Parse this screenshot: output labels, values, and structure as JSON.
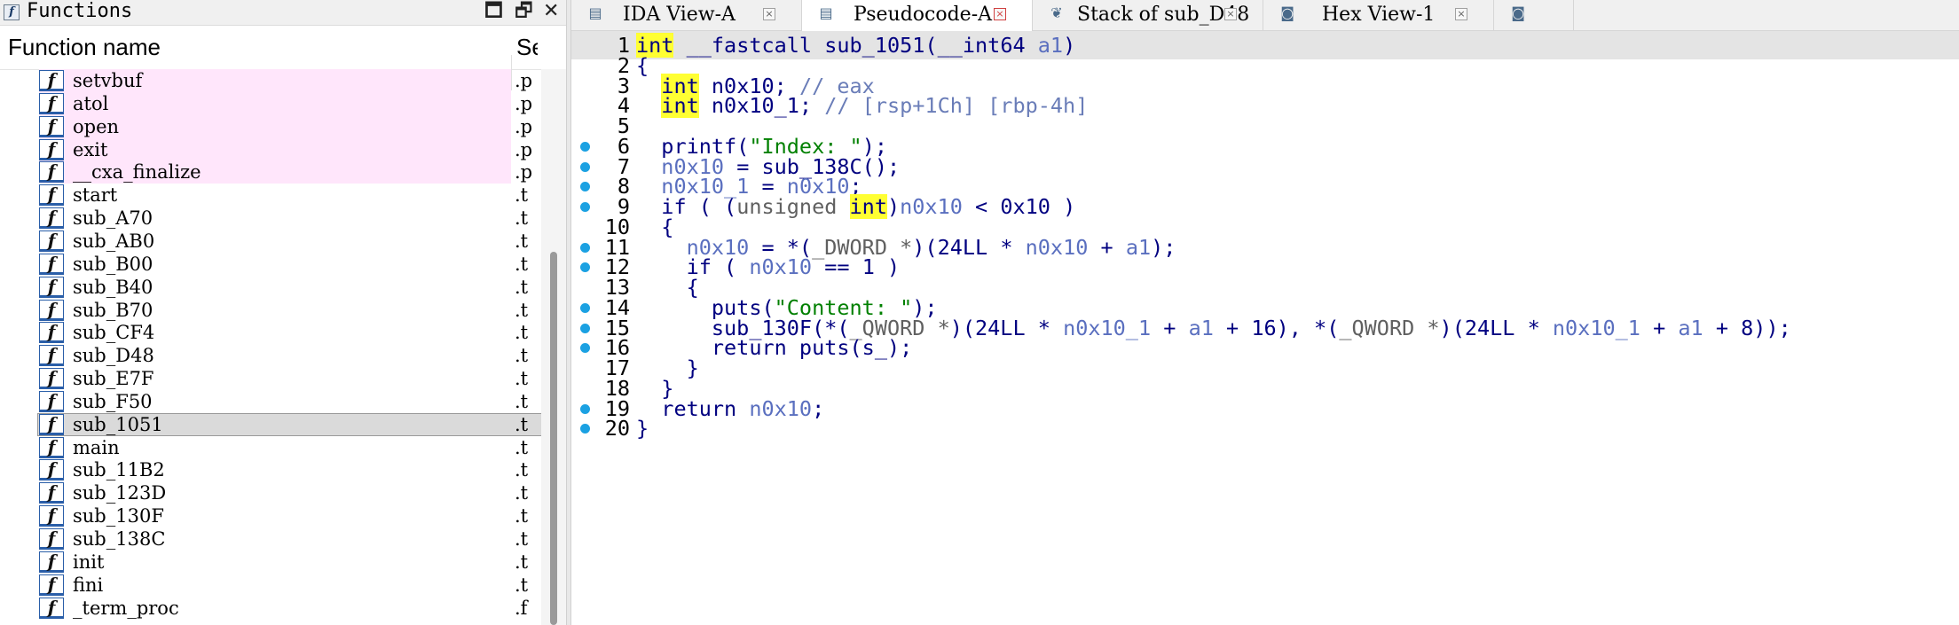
{
  "functions_panel": {
    "title": "Functions",
    "controls": {
      "maximize": "🗖",
      "float": "🗗",
      "close": "✕"
    },
    "columns": {
      "name": "Function name",
      "segment": "Se"
    },
    "rows": [
      {
        "name": "setvbuf",
        "seg": ".p",
        "kind": "import"
      },
      {
        "name": "atol",
        "seg": ".p",
        "kind": "import"
      },
      {
        "name": "open",
        "seg": ".p",
        "kind": "import"
      },
      {
        "name": "exit",
        "seg": ".p",
        "kind": "import"
      },
      {
        "name": "__cxa_finalize",
        "seg": ".p",
        "kind": "import"
      },
      {
        "name": "start",
        "seg": ".t",
        "kind": "normal"
      },
      {
        "name": "sub_A70",
        "seg": ".t",
        "kind": "normal"
      },
      {
        "name": "sub_AB0",
        "seg": ".t",
        "kind": "normal"
      },
      {
        "name": "sub_B00",
        "seg": ".t",
        "kind": "normal"
      },
      {
        "name": "sub_B40",
        "seg": ".t",
        "kind": "normal"
      },
      {
        "name": "sub_B70",
        "seg": ".t",
        "kind": "normal"
      },
      {
        "name": "sub_CF4",
        "seg": ".t",
        "kind": "normal"
      },
      {
        "name": "sub_D48",
        "seg": ".t",
        "kind": "normal"
      },
      {
        "name": "sub_E7F",
        "seg": ".t",
        "kind": "normal"
      },
      {
        "name": "sub_F50",
        "seg": ".t",
        "kind": "normal"
      },
      {
        "name": "sub_1051",
        "seg": ".t",
        "kind": "selected"
      },
      {
        "name": "main",
        "seg": ".t",
        "kind": "normal"
      },
      {
        "name": "sub_11B2",
        "seg": ".t",
        "kind": "normal"
      },
      {
        "name": "sub_123D",
        "seg": ".t",
        "kind": "normal"
      },
      {
        "name": "sub_130F",
        "seg": ".t",
        "kind": "normal"
      },
      {
        "name": "sub_138C",
        "seg": ".t",
        "kind": "normal"
      },
      {
        "name": "init",
        "seg": ".t",
        "kind": "normal"
      },
      {
        "name": "fini",
        "seg": ".t",
        "kind": "normal"
      },
      {
        "name": "_term_proc",
        "seg": ".f",
        "kind": "normal"
      }
    ],
    "function_icon_glyph": "f",
    "title_icon_glyph": "f"
  },
  "tabs": [
    {
      "label": "IDA View-A",
      "icon": "graph-view-icon",
      "glyph": "▤",
      "active": false
    },
    {
      "label": "Pseudocode-A",
      "icon": "pseudocode-icon",
      "glyph": "▤",
      "active": true
    },
    {
      "label": "Stack of sub_D48",
      "icon": "stack-icon",
      "glyph": "❦",
      "active": false
    },
    {
      "label": "Hex View-1",
      "icon": "hex-view-icon",
      "glyph": "◙",
      "active": false
    },
    {
      "label": "",
      "icon": "structures-icon",
      "glyph": "◙",
      "active": false
    }
  ],
  "tab_close_glyph": "×",
  "pseudocode": {
    "lines": [
      {
        "n": "1",
        "bp": false,
        "current": true
      },
      {
        "n": "2",
        "bp": false
      },
      {
        "n": "3",
        "bp": false
      },
      {
        "n": "4",
        "bp": false
      },
      {
        "n": "5",
        "bp": false
      },
      {
        "n": "6",
        "bp": true
      },
      {
        "n": "7",
        "bp": true
      },
      {
        "n": "8",
        "bp": true
      },
      {
        "n": "9",
        "bp": true
      },
      {
        "n": "10",
        "bp": false
      },
      {
        "n": "11",
        "bp": true
      },
      {
        "n": "12",
        "bp": true
      },
      {
        "n": "13",
        "bp": false
      },
      {
        "n": "14",
        "bp": true
      },
      {
        "n": "15",
        "bp": true
      },
      {
        "n": "16",
        "bp": true
      },
      {
        "n": "17",
        "bp": false
      },
      {
        "n": "18",
        "bp": false
      },
      {
        "n": "19",
        "bp": true
      },
      {
        "n": "20",
        "bp": true
      }
    ],
    "tokens": {
      "l1": [
        [
          "ty",
          "int"
        ],
        [
          "kw",
          " __fastcall sub_1051("
        ],
        [
          "typ",
          "__int64"
        ],
        [
          "var",
          " a1"
        ],
        [
          "kw",
          ")"
        ]
      ],
      "l2": [
        [
          "kw",
          "{"
        ]
      ],
      "l3": [
        [
          "kw",
          "  "
        ],
        [
          "ty",
          "int"
        ],
        [
          "kw",
          " n0x10; "
        ],
        [
          "cm",
          "// eax"
        ]
      ],
      "l4": [
        [
          "kw",
          "  "
        ],
        [
          "ty",
          "int"
        ],
        [
          "kw",
          " n0x10_1; "
        ],
        [
          "cm",
          "// [rsp+1Ch] [rbp-4h]"
        ]
      ],
      "l5": [
        [
          "kw",
          ""
        ]
      ],
      "l6": [
        [
          "kw",
          "  printf("
        ],
        [
          "str",
          "\"Index: \""
        ],
        [
          "kw",
          ");"
        ]
      ],
      "l7": [
        [
          "kw",
          "  "
        ],
        [
          "var",
          "n0x10"
        ],
        [
          "kw",
          " = sub_138C();"
        ]
      ],
      "l8": [
        [
          "kw",
          "  "
        ],
        [
          "var",
          "n0x10_1"
        ],
        [
          "kw",
          " = "
        ],
        [
          "var",
          "n0x10"
        ],
        [
          "kw",
          ";"
        ]
      ],
      "l9": [
        [
          "kw",
          "  if ( ("
        ],
        [
          "gr",
          "unsigned "
        ],
        [
          "ty",
          "int"
        ],
        [
          "kw",
          ")"
        ],
        [
          "var",
          "n0x10"
        ],
        [
          "kw",
          " < "
        ],
        [
          "num",
          "0x10"
        ],
        [
          "kw",
          " )"
        ]
      ],
      "l10": [
        [
          "kw",
          "  {"
        ]
      ],
      "l11": [
        [
          "kw",
          "    "
        ],
        [
          "var",
          "n0x10"
        ],
        [
          "kw",
          " = *("
        ],
        [
          "gr",
          "_DWORD *"
        ],
        [
          "kw",
          ")("
        ],
        [
          "num",
          "24LL"
        ],
        [
          "kw",
          " * "
        ],
        [
          "var",
          "n0x10"
        ],
        [
          "kw",
          " + "
        ],
        [
          "var",
          "a1"
        ],
        [
          "kw",
          ");"
        ]
      ],
      "l12": [
        [
          "kw",
          "    if ( "
        ],
        [
          "var",
          "n0x10"
        ],
        [
          "kw",
          " == "
        ],
        [
          "num",
          "1"
        ],
        [
          "kw",
          " )"
        ]
      ],
      "l13": [
        [
          "kw",
          "    {"
        ]
      ],
      "l14": [
        [
          "kw",
          "      puts("
        ],
        [
          "str",
          "\"Content: \""
        ],
        [
          "kw",
          ");"
        ]
      ],
      "l15": [
        [
          "kw",
          "      sub_130F(*("
        ],
        [
          "gr",
          "_QWORD *"
        ],
        [
          "kw",
          ")("
        ],
        [
          "num",
          "24LL"
        ],
        [
          "kw",
          " * "
        ],
        [
          "var",
          "n0x10_1"
        ],
        [
          "kw",
          " + "
        ],
        [
          "var",
          "a1"
        ],
        [
          "kw",
          " + "
        ],
        [
          "num",
          "16"
        ],
        [
          "kw",
          "), *("
        ],
        [
          "gr",
          "_QWORD *"
        ],
        [
          "kw",
          ")("
        ],
        [
          "num",
          "24LL"
        ],
        [
          "kw",
          " * "
        ],
        [
          "var",
          "n0x10_1"
        ],
        [
          "kw",
          " + "
        ],
        [
          "var",
          "a1"
        ],
        [
          "kw",
          " + "
        ],
        [
          "num",
          "8"
        ],
        [
          "kw",
          "));"
        ]
      ],
      "l16": [
        [
          "kw",
          "      return puts(s_);"
        ]
      ],
      "l17": [
        [
          "kw",
          "    }"
        ]
      ],
      "l18": [
        [
          "kw",
          "  }"
        ]
      ],
      "l19": [
        [
          "kw",
          "  return "
        ],
        [
          "var",
          "n0x10"
        ],
        [
          "kw",
          ";"
        ]
      ],
      "l20": [
        [
          "kw",
          "}"
        ]
      ]
    }
  }
}
